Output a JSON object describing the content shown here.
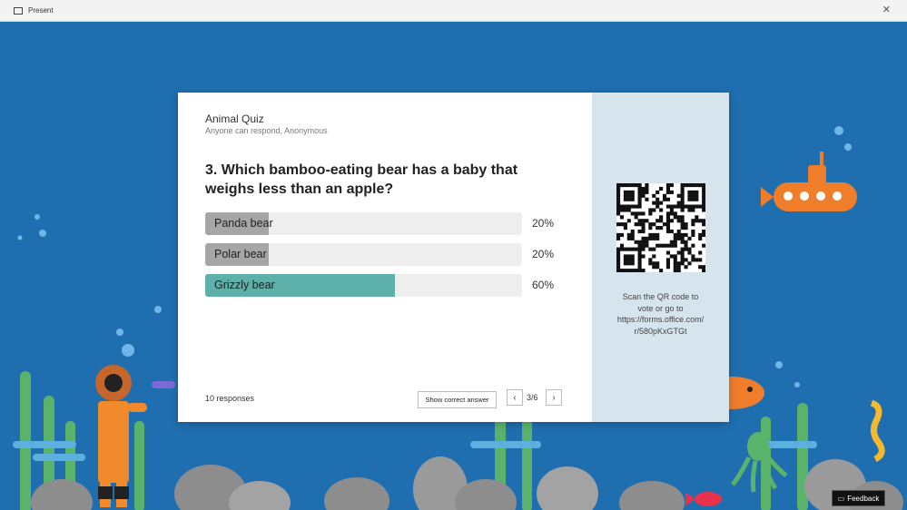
{
  "window": {
    "title": "Present"
  },
  "quiz": {
    "title": "Animal Quiz",
    "subtitle": "Anyone can respond, Anonymous",
    "question": "3. Which bamboo-eating bear has a baby that weighs less than an apple?",
    "options": [
      {
        "label": "Panda bear",
        "percent_text": "20%",
        "fraction": 0.2,
        "correct": false
      },
      {
        "label": "Polar bear",
        "percent_text": "20%",
        "fraction": 0.2,
        "correct": false
      },
      {
        "label": "Grizzly bear",
        "percent_text": "60%",
        "fraction": 0.6,
        "correct": true
      }
    ],
    "responses": "10 responses",
    "show_answer_label": "Show correct answer",
    "page_indicator": "3/6",
    "prev_icon": "chevron-left-icon",
    "next_icon": "chevron-right-icon"
  },
  "side": {
    "scan_lines": [
      "Scan the QR code to",
      "vote or go to",
      "https://forms.office.com/",
      "r/580pKxGTGt"
    ]
  },
  "feedback_label": "Feedback",
  "colors": {
    "background": "#1f6fb0",
    "bar_default": "#a6a6a6",
    "bar_correct": "#5eb0aa",
    "bar_track": "#eeeeee",
    "side_panel": "#d6e4ee"
  }
}
